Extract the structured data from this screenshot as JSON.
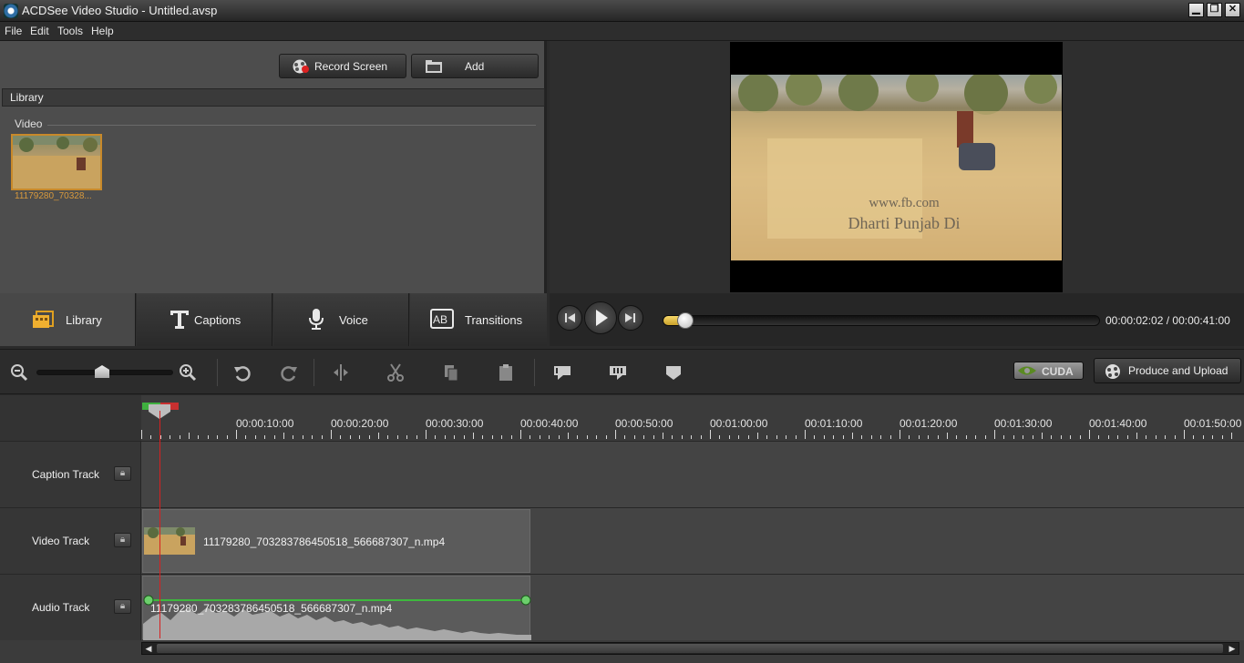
{
  "window": {
    "title": "ACDSee Video Studio - Untitled.avsp",
    "minimize": "▁",
    "maximize": "❐",
    "close": "✕"
  },
  "menu": [
    "File",
    "Edit",
    "Tools",
    "Help"
  ],
  "library_panel": {
    "record_screen_label": "Record Screen",
    "add_label": "Add",
    "header": "Library",
    "section_label": "Video",
    "items": [
      {
        "name": "11179280_70328..."
      }
    ]
  },
  "tabs": [
    {
      "label": "Library",
      "icon": "library-icon",
      "active": true
    },
    {
      "label": "Captions",
      "icon": "captions-icon",
      "active": false
    },
    {
      "label": "Voice",
      "icon": "microphone-icon",
      "active": false
    },
    {
      "label": "Transitions",
      "icon": "transitions-icon",
      "active": false
    }
  ],
  "preview": {
    "caption_line1": "www.fb.com",
    "caption_line2": "Dharti Punjab Di"
  },
  "transport": {
    "time": "00:00:02:02 / 00:00:41:00",
    "progress_fraction": 0.05
  },
  "toolbar": {
    "cuda_label": "CUDA",
    "produce_label": "Produce and Upload",
    "zoom_level_fraction": 0.48
  },
  "timeline": {
    "ruler_labels": [
      "00:00:10:00",
      "00:00:20:00",
      "00:00:30:00",
      "00:00:40:00",
      "00:00:50:00",
      "00:01:00:00",
      "00:01:10:00",
      "00:01:20:00",
      "00:01:30:00",
      "00:01:40:00",
      "00:01:50:00"
    ],
    "tracks": [
      {
        "name": "Caption Track"
      },
      {
        "name": "Video Track",
        "clip": "11179280_703283786450518_566687307_n.mp4"
      },
      {
        "name": "Audio Track",
        "clip": "11179280_703283786450518_566687307_n.mp4"
      }
    ]
  },
  "colors": {
    "accent": "#d99a3c",
    "playhead": "#d82020",
    "audio_line": "#3db83d"
  }
}
